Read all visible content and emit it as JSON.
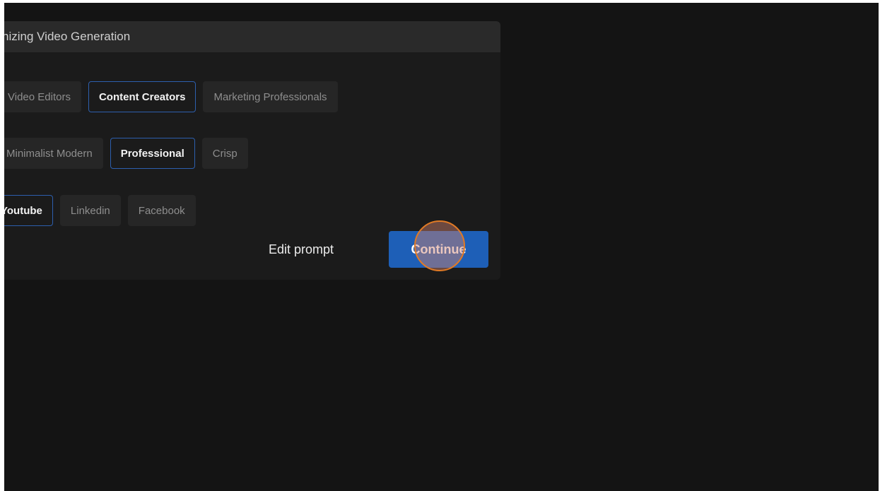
{
  "panel": {
    "title": "nizing Video Generation"
  },
  "audience_options": [
    {
      "label": "Video Editors",
      "selected": false
    },
    {
      "label": "Content Creators",
      "selected": true
    },
    {
      "label": "Marketing Professionals",
      "selected": false
    }
  ],
  "style_options": [
    {
      "label": "Minimalist Modern",
      "selected": false
    },
    {
      "label": "Professional",
      "selected": true
    },
    {
      "label": "Crisp",
      "selected": false
    }
  ],
  "platform_options": [
    {
      "label": "Youtube",
      "selected": true
    },
    {
      "label": "Linkedin",
      "selected": false
    },
    {
      "label": "Facebook",
      "selected": false
    }
  ],
  "actions": {
    "edit_prompt_label": "Edit prompt",
    "continue_label": "Continue"
  },
  "colors": {
    "accent": "#1e5fb7",
    "selected_border": "#2d5fae",
    "click_indicator": "#e07a25",
    "background": "#141414",
    "panel": "#1b1b1b"
  }
}
